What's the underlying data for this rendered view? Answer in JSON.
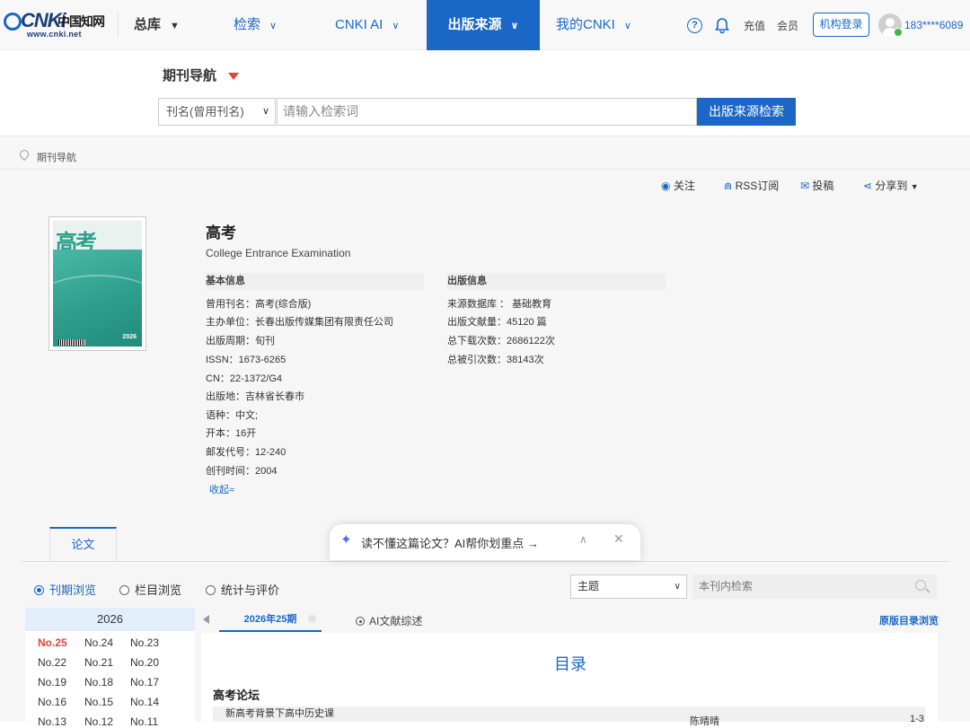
{
  "nav": {
    "logo_brand": "CNKi",
    "logo_cn": "中国知网",
    "logo_url": "www.cnki.net",
    "zongku": "总库",
    "items": [
      "检索",
      "CNKI AI",
      "出版来源",
      "我的CNKI"
    ],
    "help": "?",
    "recharge": "充值",
    "member": "会员",
    "org_login": "机构登录",
    "user": "183****6089"
  },
  "search": {
    "title": "期刊导航",
    "field": "刊名(曾用刊名)",
    "placeholder": "请输入检索词",
    "button": "出版来源检索"
  },
  "breadcrumb": "期刊导航",
  "actions": {
    "follow": "关注",
    "rss": "RSS订阅",
    "submit": "投稿",
    "share": "分享到"
  },
  "journal": {
    "cover_title": "高考",
    "cover_year": "2026",
    "title": "高考",
    "en_title": "College Entrance Examination",
    "basic_head": "基本信息",
    "pub_head": "出版信息",
    "basic": [
      "曾用刊名：高考(综合版)",
      "主办单位：长春出版传媒集团有限责任公司",
      "出版周期：旬刊",
      "ISSN：1673-6265",
      "CN：22-1372/G4",
      "出版地：吉林省长春市",
      "语种：中文;",
      "开本：16开",
      "邮发代号：12-240",
      "创刊时间：2004"
    ],
    "pub": [
      "来源数据库 ： 基础教育",
      "出版文献量：45120 篇",
      "总下载次数：2686122次",
      "总被引次数：38143次"
    ],
    "collapse": "收起≈"
  },
  "tabs": {
    "papers": "论文",
    "browse_issue": "刊期浏览",
    "browse_column": "栏目浏览",
    "stats": "统计与评价",
    "theme": "主题",
    "in_search_ph": "本刊内检索"
  },
  "issues": {
    "year": "2026",
    "list": [
      "No.25",
      "No.24",
      "No.23",
      "No.22",
      "No.21",
      "No.20",
      "No.19",
      "No.18",
      "No.17",
      "No.16",
      "No.15",
      "No.14",
      "No.13",
      "No.12",
      "No.11"
    ],
    "active": "No.25"
  },
  "toc": {
    "issue_tab": "2026年25期",
    "ai_summary": "AI文献综述",
    "orig_link": "原版目录浏览",
    "title": "目录",
    "section": "高考论坛",
    "row_title": "新高考背景下高中历史课",
    "row_author": "陈晴晴",
    "row_page": "1-3"
  },
  "ai_popup": {
    "text": "读不懂这篇论文？AI帮你划重点 →"
  },
  "colors": {
    "accent": "#1b67c6",
    "red": "#e2453a"
  }
}
